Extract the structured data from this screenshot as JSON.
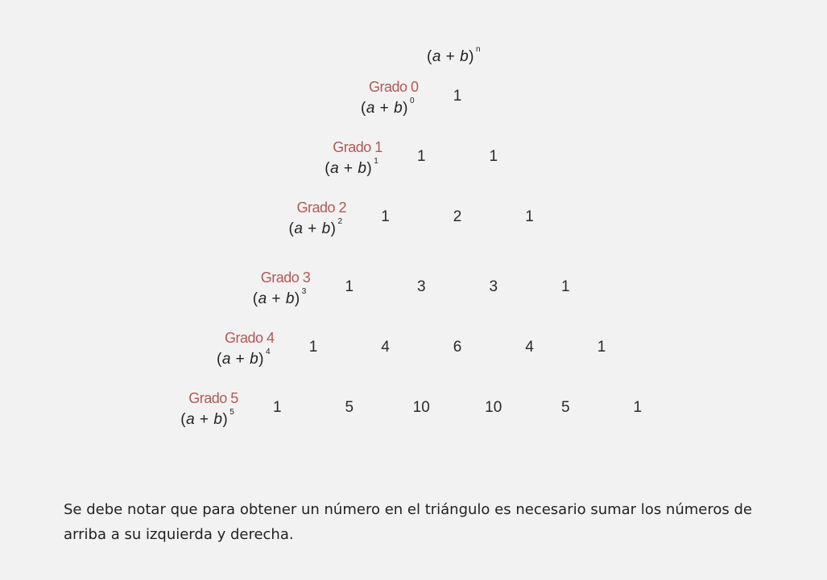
{
  "header": {
    "open": "(",
    "a": "a",
    "plus": " + ",
    "b": "b",
    "close": ")",
    "exp": "n"
  },
  "rows": [
    {
      "label": "Grado 0",
      "exp": "0",
      "values": [
        "1"
      ]
    },
    {
      "label": "Grado 1",
      "exp": "1",
      "values": [
        "1",
        "1"
      ]
    },
    {
      "label": "Grado 2",
      "exp": "2",
      "values": [
        "1",
        "2",
        "1"
      ]
    },
    {
      "label": "Grado 3",
      "exp": "3",
      "values": [
        "1",
        "3",
        "3",
        "1"
      ]
    },
    {
      "label": "Grado 4",
      "exp": "4",
      "values": [
        "1",
        "4",
        "6",
        "4",
        "1"
      ]
    },
    {
      "label": "Grado 5",
      "exp": "5",
      "values": [
        "1",
        "5",
        "10",
        "10",
        "5",
        "1"
      ]
    }
  ],
  "caption": "Se debe notar que para obtener un número en el triángulo es necesario sumar los números de arriba a su izquierda y derecha.",
  "colors": {
    "grado_label": "#b05a55",
    "background": "#f2f2f2",
    "text": "#222222"
  }
}
